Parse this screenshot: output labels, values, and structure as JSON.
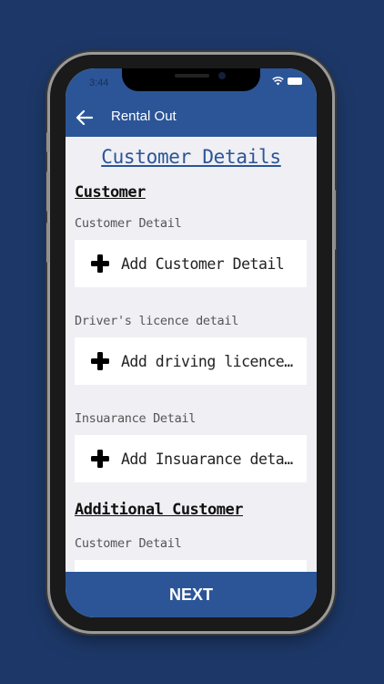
{
  "status_bar": {
    "time": "3:44"
  },
  "app_bar": {
    "back_icon": "arrow-left-icon",
    "title": "Rental Out"
  },
  "page": {
    "heading": "Customer Details"
  },
  "customer_section": {
    "heading": "Customer",
    "fields": [
      {
        "label": "Customer Detail",
        "action": "Add Customer Detail"
      },
      {
        "label": "Driver's licence detail",
        "action": "Add driving licence…"
      },
      {
        "label": "Insuarance Detail",
        "action": "Add Insuarance detail"
      }
    ]
  },
  "additional_section": {
    "heading": "Additional Customer",
    "fields": [
      {
        "label": "Customer Detail"
      }
    ]
  },
  "footer": {
    "next_label": "NEXT"
  },
  "colors": {
    "brand": "#2b5597",
    "page_bg": "#efeff4",
    "outer_bg": "#1d3868"
  }
}
